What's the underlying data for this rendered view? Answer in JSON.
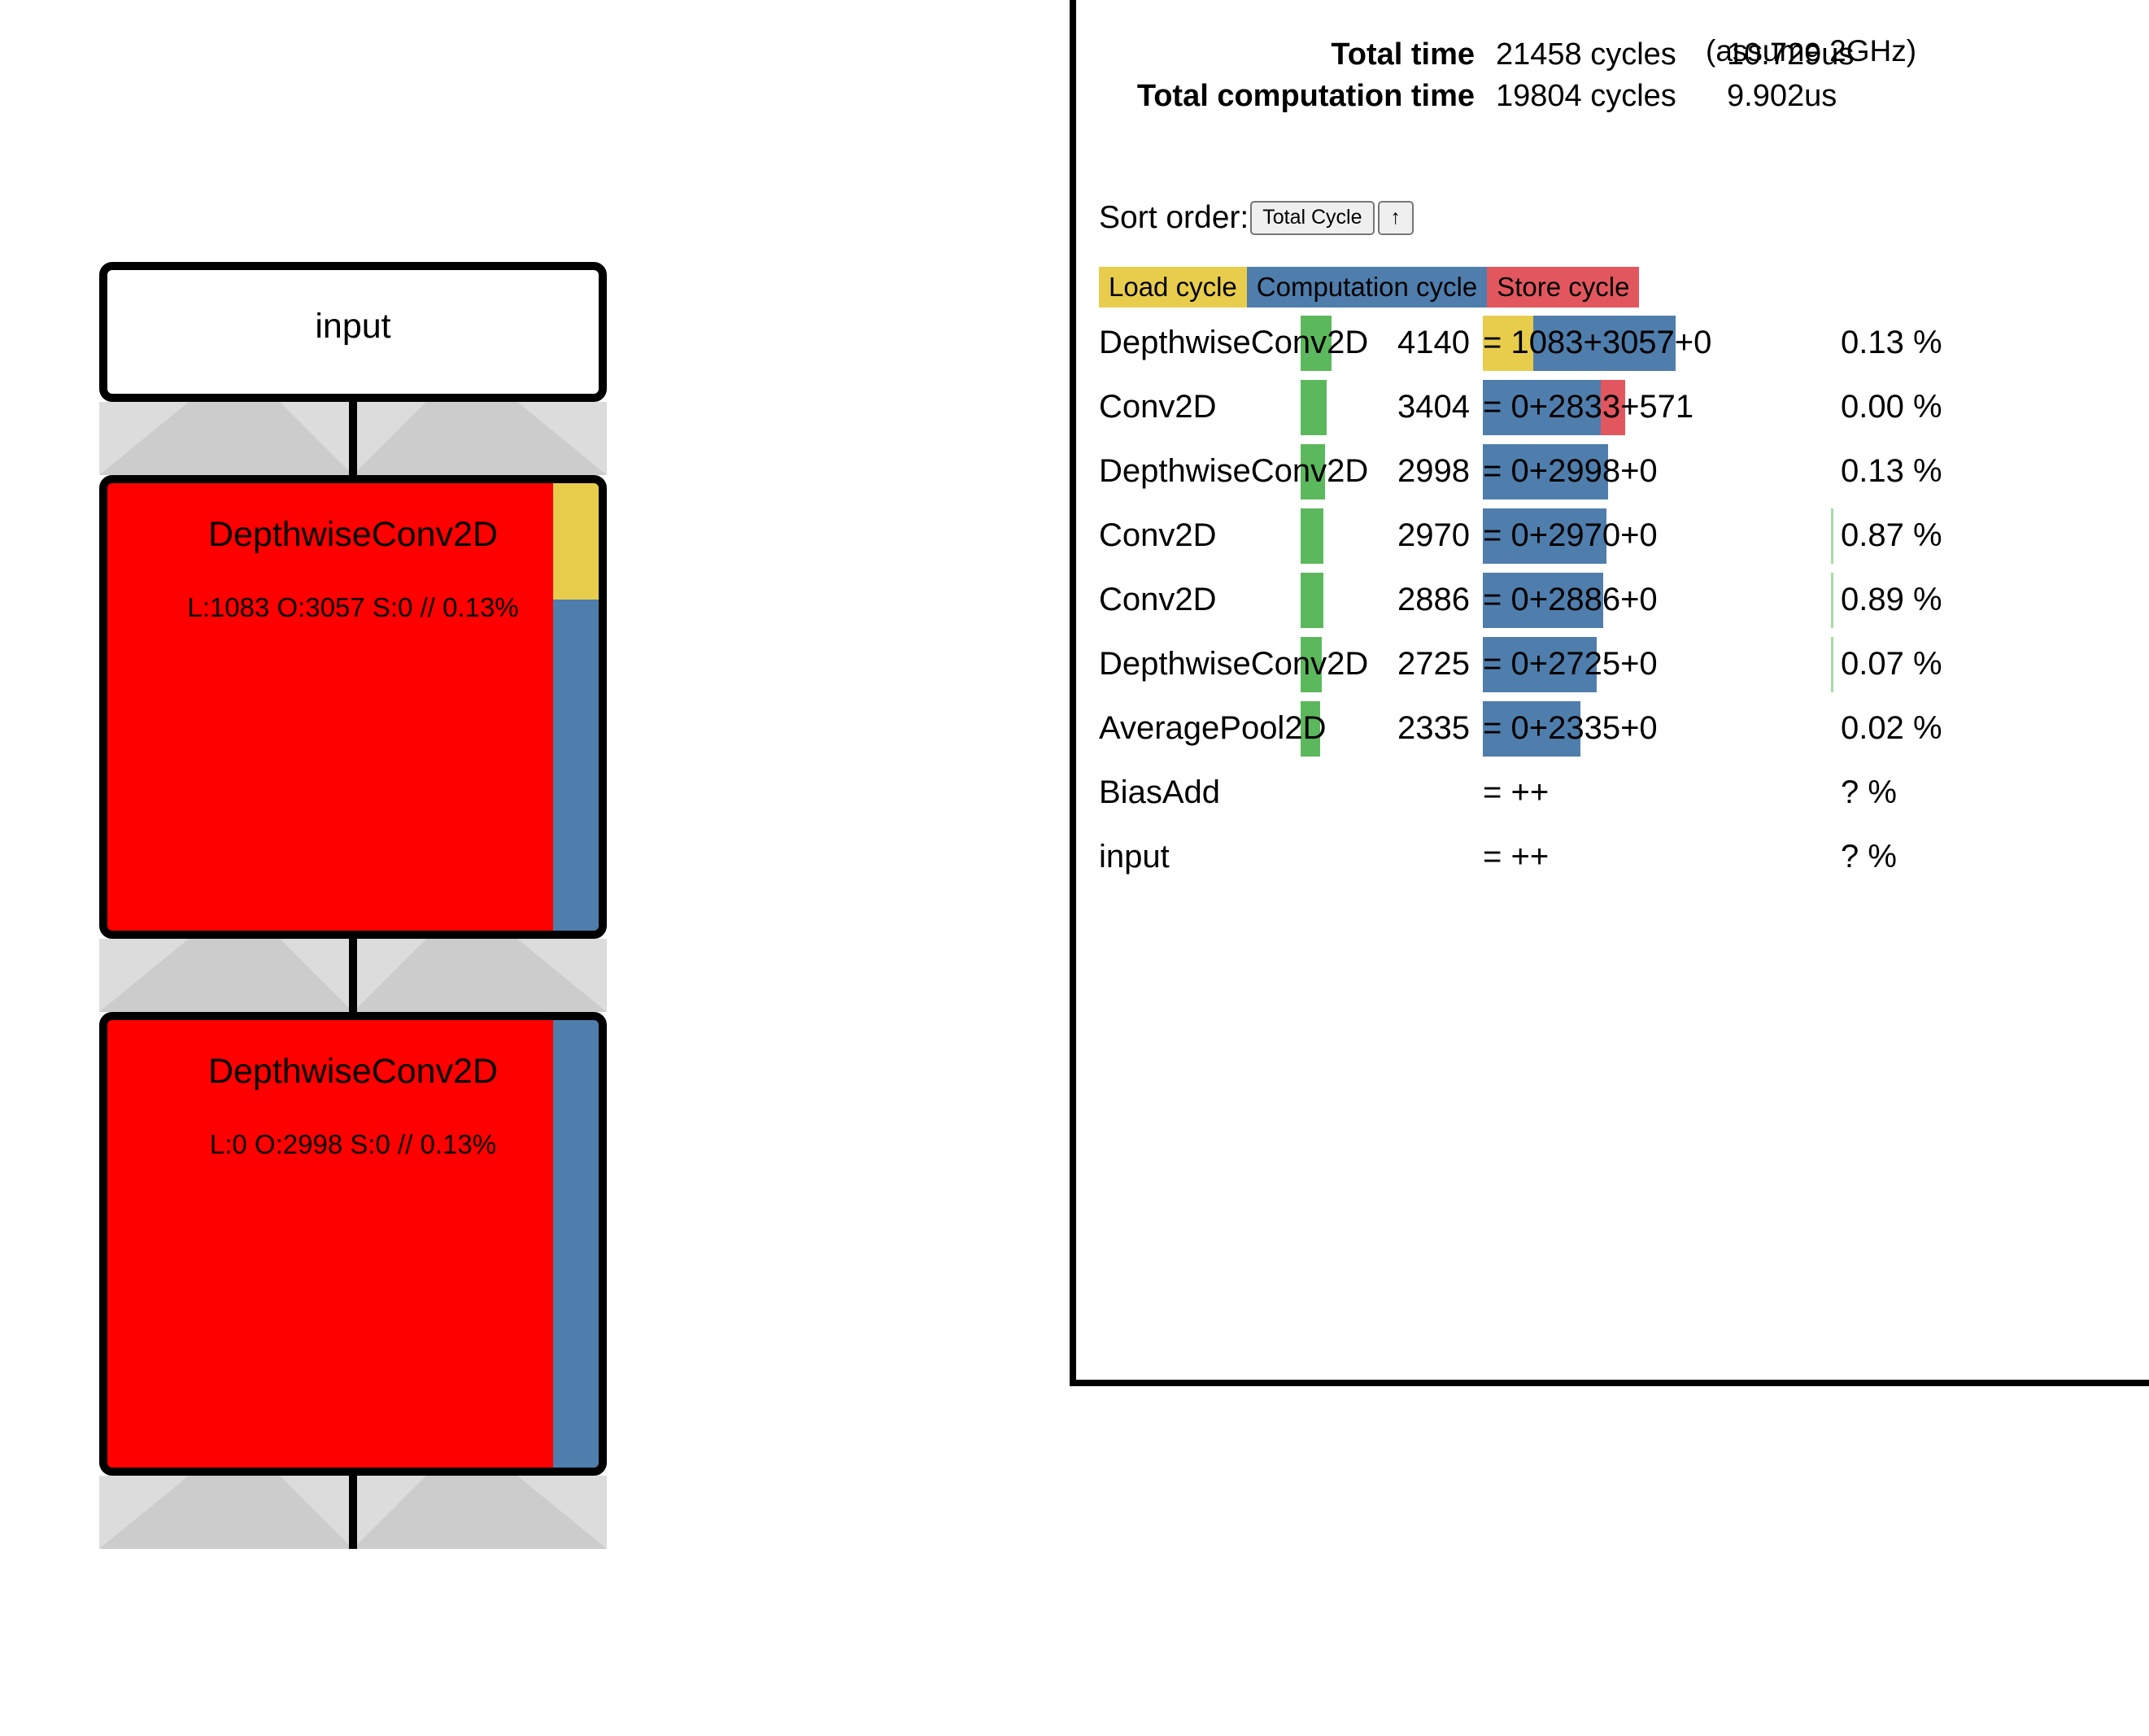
{
  "graph": {
    "nodes": [
      {
        "type": "io",
        "title": "input",
        "subtitle": ""
      },
      {
        "type": "op",
        "title": "DepthwiseConv2D",
        "subtitle": "L:1083 O:3057 S:0 // 0.13%",
        "strip": [
          {
            "color": "#e8cd4d",
            "ratio": 26
          },
          {
            "color": "#4f7ead",
            "ratio": 74
          }
        ]
      },
      {
        "type": "op",
        "title": "DepthwiseConv2D",
        "subtitle": "L:0 O:2998 S:0 // 0.13%",
        "strip": [
          {
            "color": "#4f7ead",
            "ratio": 100
          }
        ]
      }
    ]
  },
  "profile": {
    "assume_note": "(assume 2GHz)",
    "summary": [
      {
        "label": "Total time",
        "cycles": "21458 cycles",
        "time": "10.729us"
      },
      {
        "label": "Total computation time",
        "cycles": "19804 cycles",
        "time": "9.902us"
      }
    ],
    "sort": {
      "label": "Sort order:",
      "selected": "Total Cycle",
      "direction": "↑"
    },
    "legend": [
      {
        "label": "Load cycle",
        "color": "#e8cd4d"
      },
      {
        "label": "Computation cycle",
        "color": "#4f7ead"
      },
      {
        "label": "Store cycle",
        "color": "#e2575e"
      }
    ],
    "rows": [
      {
        "op": "DepthwiseConv2D",
        "total": "4140",
        "breakdown": "= 1083+3057+0",
        "pct": "0.13 %",
        "green_w": 38,
        "bars": [
          {
            "color": "#e8cd4d",
            "w": 62
          },
          {
            "color": "#4f7ead",
            "w": 175
          }
        ],
        "has_sep": false
      },
      {
        "op": "Conv2D",
        "total": "3404",
        "breakdown": "= 0+2833+571",
        "pct": "0.00 %",
        "green_w": 32,
        "bars": [
          {
            "color": "#4f7ead",
            "w": 145
          },
          {
            "color": "#e2575e",
            "w": 30
          }
        ],
        "has_sep": false
      },
      {
        "op": "DepthwiseConv2D",
        "total": "2998",
        "breakdown": "= 0+2998+0",
        "pct": "0.13 %",
        "green_w": 30,
        "bars": [
          {
            "color": "#4f7ead",
            "w": 154
          }
        ],
        "has_sep": false
      },
      {
        "op": "Conv2D",
        "total": "2970",
        "breakdown": "= 0+2970+0",
        "pct": "0.87 %",
        "green_w": 28,
        "bars": [
          {
            "color": "#4f7ead",
            "w": 152
          }
        ],
        "has_sep": true
      },
      {
        "op": "Conv2D",
        "total": "2886",
        "breakdown": "= 0+2886+0",
        "pct": "0.89 %",
        "green_w": 28,
        "bars": [
          {
            "color": "#4f7ead",
            "w": 148
          }
        ],
        "has_sep": true
      },
      {
        "op": "DepthwiseConv2D",
        "total": "2725",
        "breakdown": "= 0+2725+0",
        "pct": "0.07 %",
        "green_w": 26,
        "bars": [
          {
            "color": "#4f7ead",
            "w": 140
          }
        ],
        "has_sep": true
      },
      {
        "op": "AveragePool2D",
        "total": "2335",
        "breakdown": "= 0+2335+0",
        "pct": "0.02 %",
        "green_w": 24,
        "bars": [
          {
            "color": "#4f7ead",
            "w": 120
          }
        ],
        "has_sep": false
      },
      {
        "op": "BiasAdd",
        "total": "",
        "breakdown": "= ++",
        "pct": "? %",
        "green_w": 0,
        "bars": [],
        "has_sep": false
      },
      {
        "op": "input",
        "total": "",
        "breakdown": "= ++",
        "pct": "? %",
        "green_w": 0,
        "bars": [],
        "has_sep": false
      }
    ]
  }
}
